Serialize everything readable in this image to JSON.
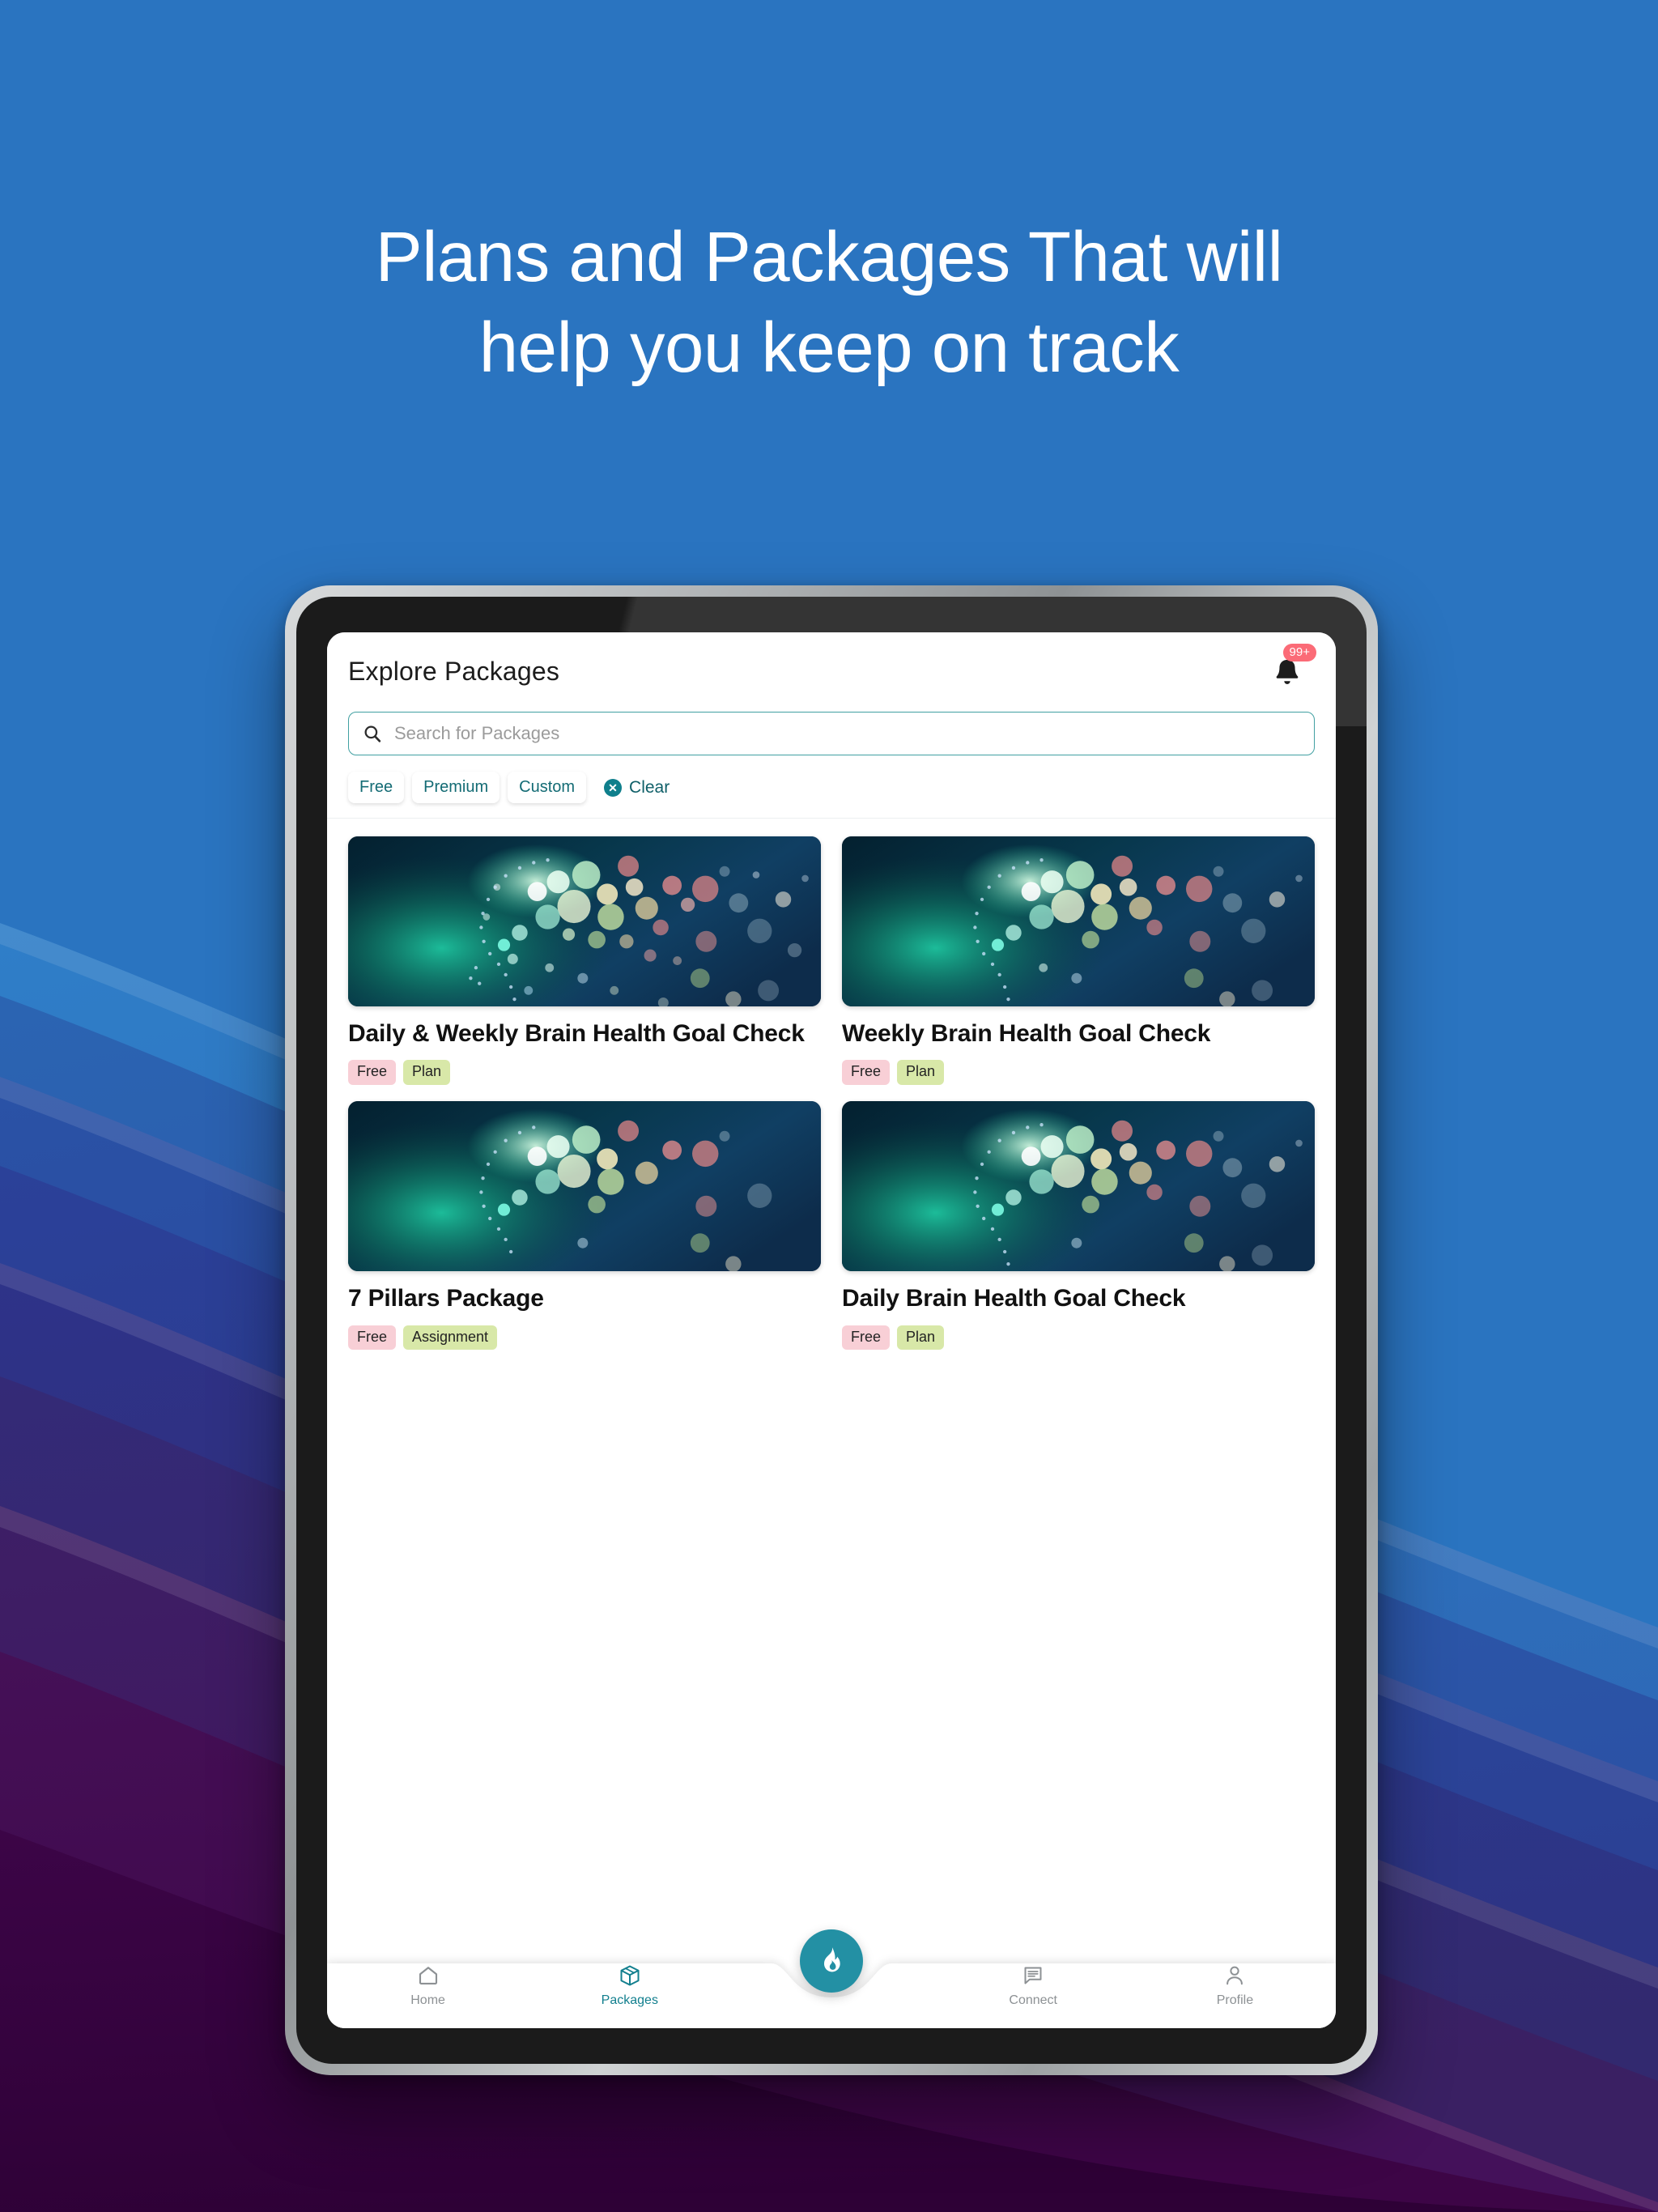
{
  "headline": {
    "line1": "Plans and Packages That will",
    "line2": "help you keep on track"
  },
  "colors": {
    "background_blue": "#2a74c0",
    "wave_deep_purple": "#3a0a4a",
    "accent_teal": "#127f8e",
    "badge_coral": "#fb6b77",
    "tag_free_bg": "#f8cfd6",
    "tag_plan_bg": "#d8e8a8",
    "search_border_teal": "#41a0a2"
  },
  "app": {
    "title": "Explore Packages",
    "notification": {
      "icon": "bell-icon",
      "badge_count": "99+"
    },
    "search": {
      "icon": "search-icon",
      "value": "",
      "placeholder": "Search for Packages"
    },
    "filters": {
      "chips": [
        {
          "label": "Free"
        },
        {
          "label": "Premium"
        },
        {
          "label": "Custom"
        }
      ],
      "clear": {
        "label": "Clear",
        "icon": "close-circle-icon"
      }
    },
    "packages": [
      {
        "title": "Daily & Weekly Brain Health Goal Check",
        "image": "brain-particles-thumbnail",
        "tags": [
          {
            "label": "Free",
            "style": "free"
          },
          {
            "label": "Plan",
            "style": "plan"
          }
        ]
      },
      {
        "title": "Weekly Brain Health Goal Check",
        "image": "brain-particles-thumbnail",
        "tags": [
          {
            "label": "Free",
            "style": "free"
          },
          {
            "label": "Plan",
            "style": "plan"
          }
        ]
      },
      {
        "title": "7 Pillars Package",
        "image": "brain-particles-thumbnail",
        "tags": [
          {
            "label": "Free",
            "style": "free"
          },
          {
            "label": "Assignment",
            "style": "assignment"
          }
        ]
      },
      {
        "title": "Daily Brain Health Goal Check",
        "image": "brain-particles-thumbnail",
        "tags": [
          {
            "label": "Free",
            "style": "free"
          },
          {
            "label": "Plan",
            "style": "plan"
          }
        ]
      }
    ],
    "bottom_nav": {
      "items": [
        {
          "label": "Home",
          "icon": "home-icon",
          "active": false
        },
        {
          "label": "Packages",
          "icon": "package-box-icon",
          "active": true
        },
        {
          "label": "Connect",
          "icon": "chat-bubble-icon",
          "active": false
        },
        {
          "label": "Profile",
          "icon": "person-icon",
          "active": false
        }
      ],
      "fab": {
        "icon": "flame-icon"
      }
    }
  }
}
